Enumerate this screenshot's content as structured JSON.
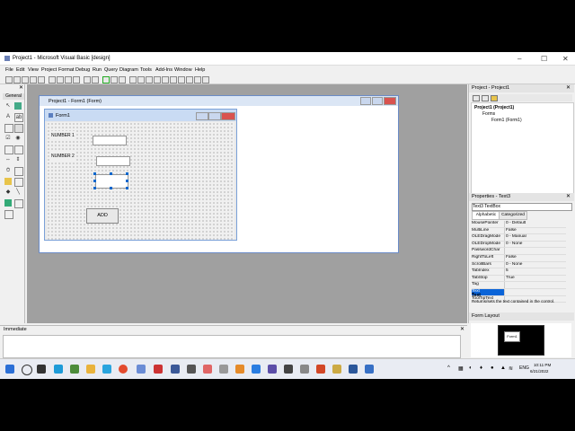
{
  "window": {
    "title": "Project1 - Microsoft Visual Basic [design]",
    "min": "–",
    "max": "☐",
    "close": "✕"
  },
  "menu": [
    "File",
    "Edit",
    "View",
    "Project",
    "Format",
    "Debug",
    "Run",
    "Query",
    "Diagram",
    "Tools",
    "Add-Ins",
    "Window",
    "Help"
  ],
  "toolbox": {
    "tab": "General",
    "close": "✕"
  },
  "project_window": {
    "title": "Project1 - Form1 (Form)"
  },
  "form": {
    "title": "Form1",
    "label1": "NUMBER 1",
    "label2": "NUMBER 2",
    "button": "ADD"
  },
  "project_explorer": {
    "title": "Project - Project1",
    "project": "Project1 (Project1)",
    "folder": "Forms",
    "item": "Form1 (Form1)"
  },
  "properties": {
    "title": "Properties - Text3",
    "object": "Text3 TextBox",
    "tab_alpha": "Alphabetic",
    "tab_cat": "Categorized",
    "rows": [
      {
        "k": "MousePointer",
        "v": "0 - Default"
      },
      {
        "k": "MultiLine",
        "v": "False"
      },
      {
        "k": "OLEDragMode",
        "v": "0 - Manual"
      },
      {
        "k": "OLEDropMode",
        "v": "0 - None"
      },
      {
        "k": "PasswordChar",
        "v": ""
      },
      {
        "k": "RightToLeft",
        "v": "False"
      },
      {
        "k": "ScrollBars",
        "v": "0 - None"
      },
      {
        "k": "TabIndex",
        "v": "5"
      },
      {
        "k": "TabStop",
        "v": "True"
      },
      {
        "k": "Tag",
        "v": ""
      },
      {
        "k": "Text",
        "v": ""
      },
      {
        "k": "ToolTipText",
        "v": ""
      }
    ],
    "desc_title": "Text",
    "desc": "Returns/sets the text contained in the control."
  },
  "form_layout": {
    "title": "Form Layout",
    "mini_form": "Form1"
  },
  "immediate": {
    "title": "Immediate"
  },
  "taskbar": {
    "time": "10:11 PM",
    "date": "6/21/2022",
    "lang": "ENG"
  }
}
